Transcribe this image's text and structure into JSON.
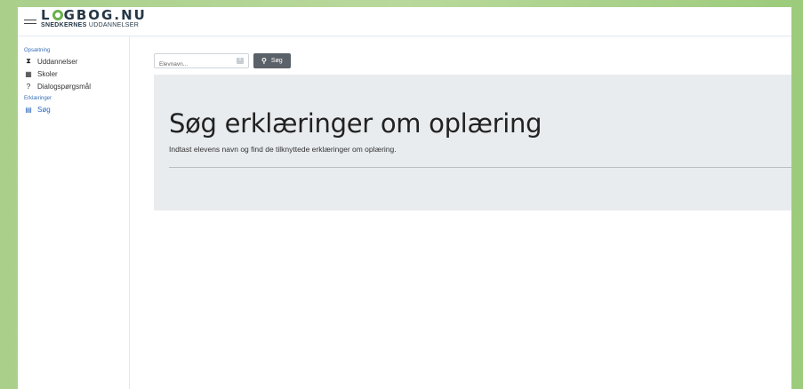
{
  "header": {
    "logo_main_prefix": "L",
    "logo_main_suffix": "GBOG.NU",
    "logo_sub_bold": "SNEDKERNES",
    "logo_sub_rest": " UDDANNELSER",
    "brand_color": "#6ab04c"
  },
  "sidebar": {
    "section1": "Opsætning",
    "items1": [
      {
        "label": "Uddannelser",
        "icon": "graduation-cap-icon"
      },
      {
        "label": "Skoler",
        "icon": "school-icon"
      },
      {
        "label": "Dialogspørgsmål",
        "icon": "question-icon"
      }
    ],
    "section2": "Erklæringer",
    "items2": [
      {
        "label": "Søg",
        "icon": "document-icon",
        "active": true
      }
    ],
    "active_color": "#2a66c4"
  },
  "search": {
    "placeholder": "Elevnavn...",
    "value": "",
    "button_label": "Søg"
  },
  "main": {
    "title": "Søg erklæringer om oplæring",
    "subtitle": "Indtast elevens navn og find de tilknyttede erklæringer om oplæring."
  }
}
